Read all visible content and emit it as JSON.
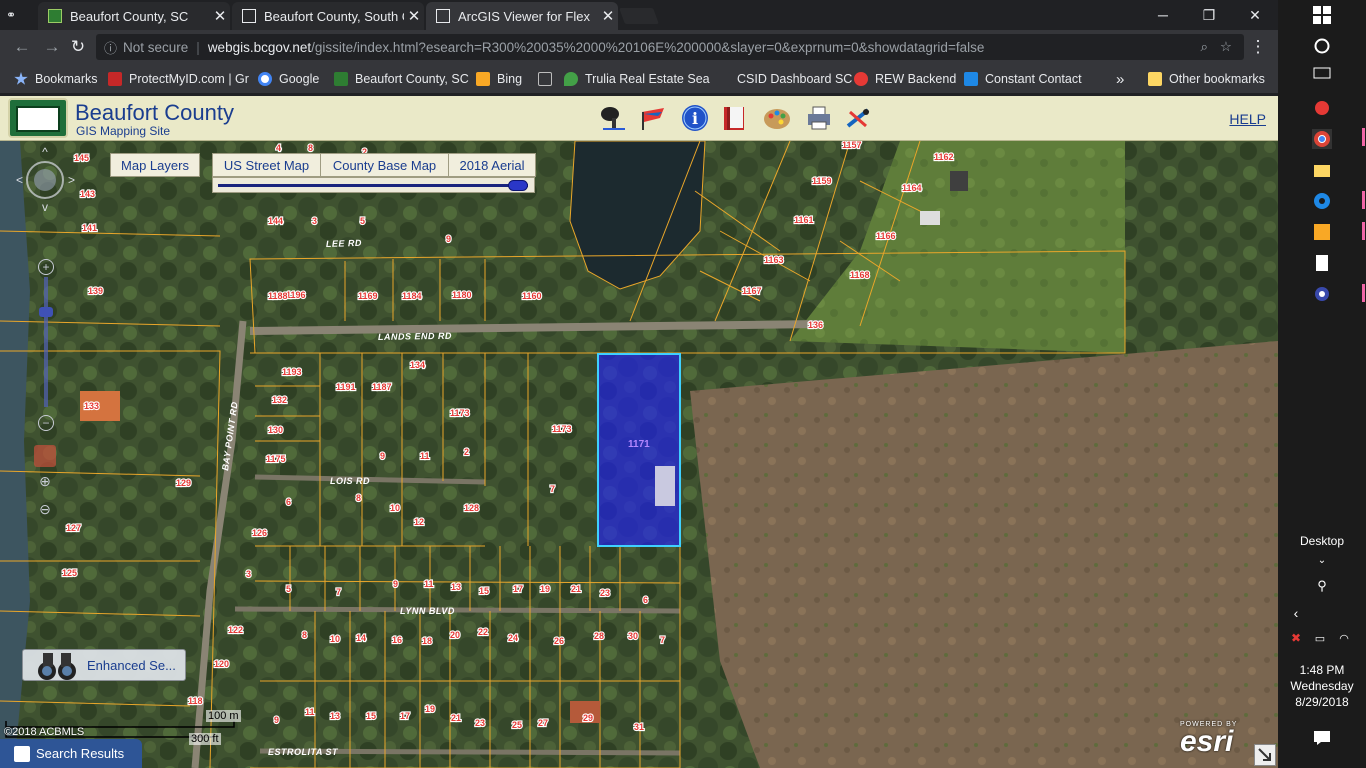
{
  "browser": {
    "tabs": [
      {
        "title": "Beaufort County, SC",
        "active": false
      },
      {
        "title": "Beaufort County, South C",
        "active": false
      },
      {
        "title": "ArcGIS Viewer for Flex",
        "active": true
      }
    ],
    "window_controls": {
      "minimize": "─",
      "restore": "❐",
      "close": "✕"
    },
    "address": {
      "security": "Not secure",
      "host": "webgis.bcgov.net",
      "path": "/gissite/index.html?esearch=R300%20035%2000%20106E%200000&slayer=0&exprnum=0&showdatagrid=false"
    },
    "bookmarks": [
      {
        "label": "Bookmarks",
        "color": "#8ab4f8"
      },
      {
        "label": "ProtectMyID.com | Gr",
        "color": "#c62828"
      },
      {
        "label": "Google",
        "color": "#4285f4"
      },
      {
        "label": "Beaufort County, SC",
        "color": "#2e7d32"
      },
      {
        "label": "Bing",
        "color": "#f9a825"
      },
      {
        "label": "",
        "color": "#bdbdbd"
      },
      {
        "label": "Trulia Real Estate Sea",
        "color": "#43a047"
      },
      {
        "label": "CSID Dashboard SC",
        "color": "#35363a"
      },
      {
        "label": "REW Backend",
        "color": "#e53935"
      },
      {
        "label": "Constant Contact",
        "color": "#1e88e5"
      }
    ],
    "bookmarks_more": "»",
    "other_bookmarks": "Other bookmarks"
  },
  "app": {
    "title": "Beaufort County",
    "subtitle": "GIS Mapping Site",
    "help": "HELP",
    "toolbar_icons": [
      "search-identify-icon",
      "bookmark-flag-icon",
      "info-icon",
      "legend-book-icon",
      "draw-palette-icon",
      "print-icon",
      "measure-icon"
    ],
    "layer_buttons": {
      "map_layers": "Map Layers",
      "street": "US Street Map",
      "base": "County Base Map",
      "aerial": "2018 Aerial"
    },
    "opacity_level": 1.0,
    "enhanced_search": "Enhanced Se...",
    "search_results": "Search Results",
    "scale": {
      "metric": "100 m",
      "imperial": "300 ft"
    },
    "copyright": "©2018 ACBMLS",
    "esri": {
      "powered_by": "POWERED BY",
      "name": "esri"
    }
  },
  "map_labels": {
    "roads": [
      "LEE RD",
      "LANDS END RD",
      "BAY POINT RD",
      "LOIS RD",
      "LYNN BLVD",
      "ESTROLITA ST"
    ],
    "selected_parcel": "1171",
    "parcels": [
      "145",
      "143",
      "141",
      "139",
      "133",
      "129",
      "127",
      "125",
      "122",
      "120",
      "118",
      "144",
      "3",
      "5",
      "9",
      "8",
      "4",
      "2",
      "1196",
      "1188",
      "1169",
      "1184",
      "1180",
      "1160",
      "1157",
      "1162",
      "1159",
      "1164",
      "1161",
      "1166",
      "1163",
      "1168",
      "1167",
      "136",
      "1193",
      "1191",
      "1187",
      "134",
      "132",
      "130",
      "1175",
      "1173",
      "1173",
      "7",
      "9",
      "11",
      "2",
      "6",
      "8",
      "10",
      "12",
      "128",
      "126",
      "3",
      "5",
      "7",
      "9",
      "11",
      "13",
      "15",
      "17",
      "19",
      "21",
      "23",
      "6",
      "8",
      "10",
      "14",
      "16",
      "18",
      "20",
      "22",
      "24",
      "26",
      "28",
      "30",
      "7",
      "9",
      "11",
      "13",
      "15",
      "17",
      "19",
      "21",
      "23",
      "25",
      "27",
      "29",
      "31"
    ]
  },
  "taskbar": {
    "desktop": "Desktop",
    "time": "1:48 PM",
    "day": "Wednesday",
    "date": "8/29/2018"
  }
}
